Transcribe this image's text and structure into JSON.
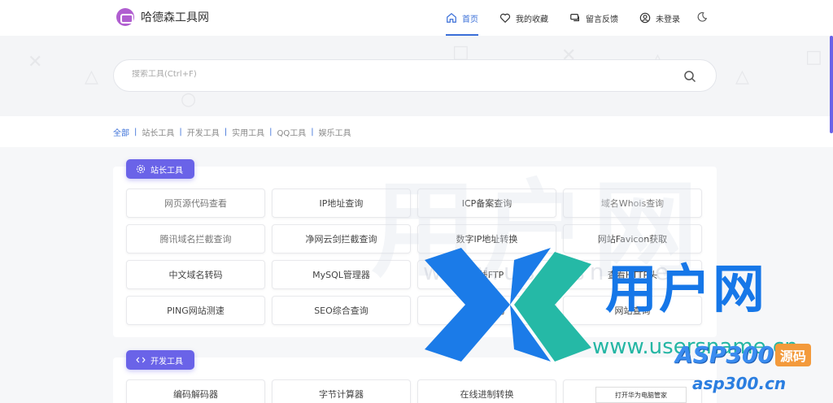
{
  "header": {
    "brand_name": "哈德森工具网",
    "nav": [
      {
        "label": "首页",
        "icon": "home-icon",
        "active": true
      },
      {
        "label": "我的收藏",
        "icon": "heart-icon",
        "active": false
      },
      {
        "label": "留言反馈",
        "icon": "message-icon",
        "active": false
      },
      {
        "label": "未登录",
        "icon": "user-icon",
        "active": false
      }
    ],
    "theme_icon": "moon-icon"
  },
  "search": {
    "placeholder": "搜索工具(Ctrl+F)"
  },
  "categories": {
    "items": [
      "全部",
      "站长工具",
      "开发工具",
      "实用工具",
      "QQ工具",
      "娱乐工具"
    ],
    "separator": "|",
    "active_index": 0
  },
  "sections": [
    {
      "title": "站长工具",
      "icon": "gear-icon",
      "tools": [
        "网页源代码查看",
        "IP地址查询",
        "ICP备案查询",
        "域名Whois查询",
        "腾讯域名拦截查询",
        "净网云剑拦截查询",
        "数字IP地址转换",
        "网站Favicon获取",
        "中文域名转码",
        "MySQL管理器",
        "在线FTP",
        "查看HTTP头",
        "PING网站测速",
        "SEO综合查询",
        "网站查询",
        "网站查询"
      ]
    },
    {
      "title": "开发工具",
      "icon": "code-icon",
      "tools": [
        "编码解码器",
        "字节计算器",
        "在线进制转换",
        ""
      ]
    }
  ],
  "overlay": {
    "watermark_main": "用户网",
    "watermark_url": "www.usersname.cn",
    "watermark_big": "用户网",
    "watermark_www": "www.usersname",
    "asp_text": "ASP300",
    "asp_badge": "源码",
    "asp_url": "asp300.cn",
    "tooltip": "打开华为电脑管家"
  },
  "colors": {
    "accent": "#3a6fd8",
    "section_tag": "#6a63e8",
    "watermark_blue": "#1677e8",
    "watermark_green": "#24b6a4"
  }
}
